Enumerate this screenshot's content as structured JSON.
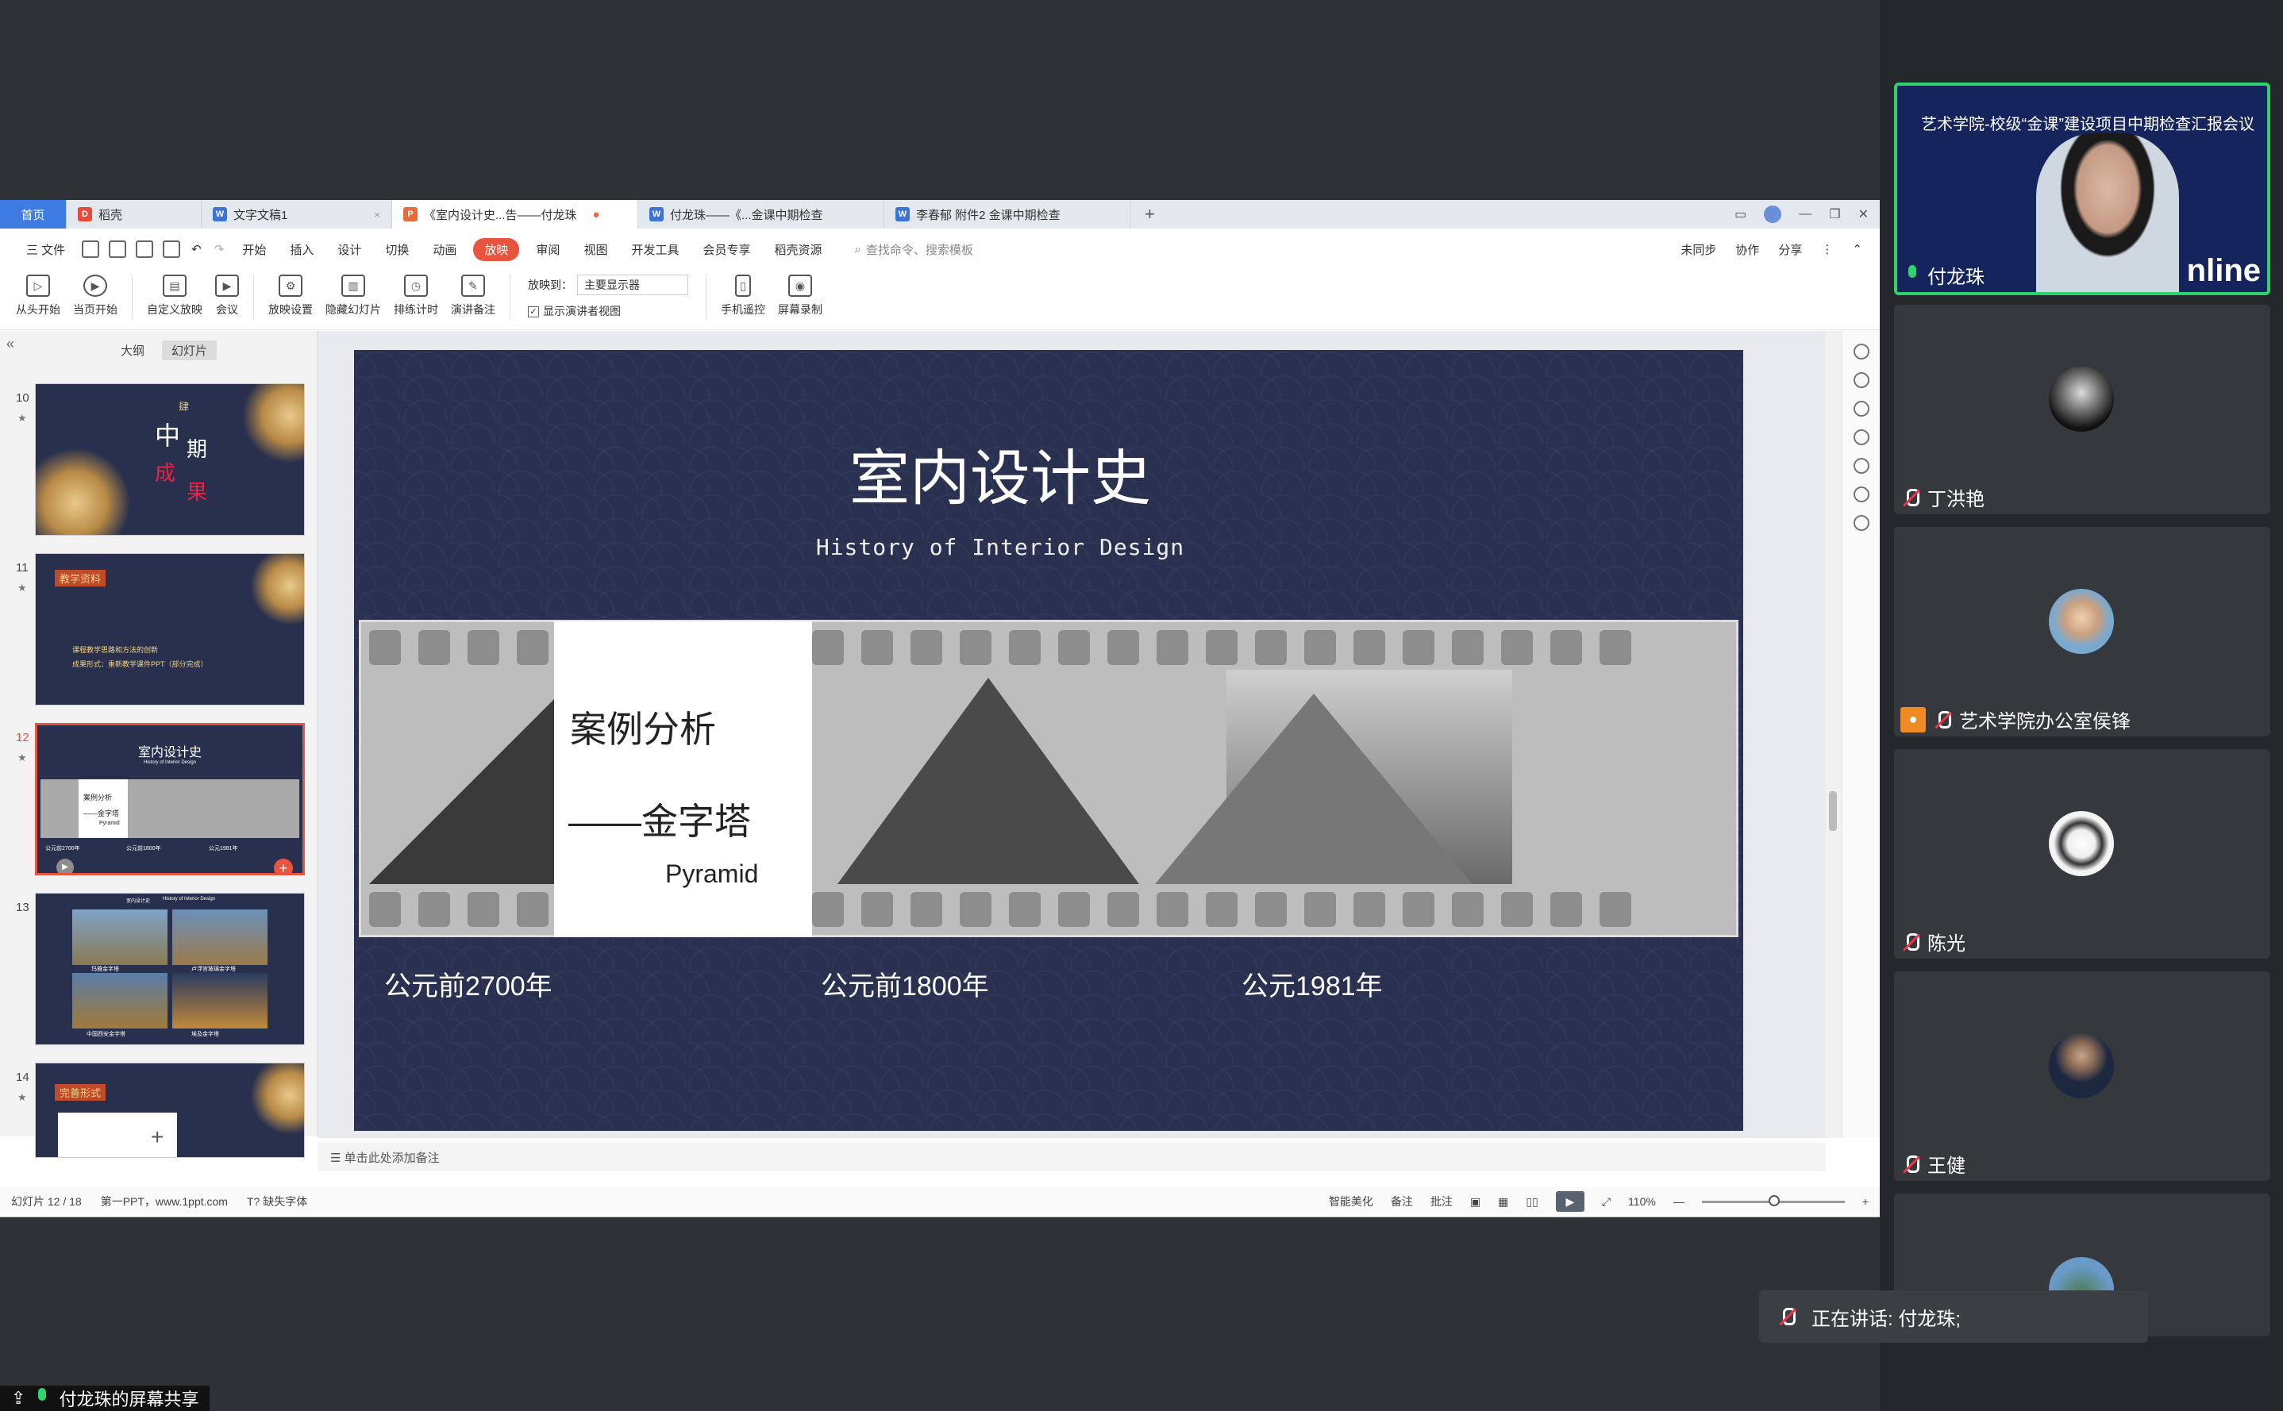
{
  "wps": {
    "tabs": [
      {
        "label": "首页"
      },
      {
        "label": "稻壳",
        "icon": "docer-icon"
      },
      {
        "label": "文字文稿1",
        "icon": "word-icon"
      },
      {
        "label": "《室内设计史...告——付龙珠",
        "icon": "ppt-icon"
      },
      {
        "label": "付龙珠——《...金课中期检查",
        "icon": "word-icon"
      },
      {
        "label": "李春郁 附件2 金课中期检查",
        "icon": "word-icon"
      }
    ],
    "menu": {
      "file": "三 文件",
      "items": [
        "开始",
        "插入",
        "设计",
        "切换",
        "动画",
        "放映",
        "审阅",
        "视图",
        "开发工具",
        "会员专享",
        "稻壳资源"
      ],
      "active": "放映",
      "search": "查找命令、搜索模板",
      "right": [
        "未同步",
        "协作",
        "分享"
      ]
    },
    "ribbon": {
      "buttons": [
        "从头开始",
        "当页开始",
        "自定义放映",
        "会议",
        "放映设置",
        "隐藏幻灯片",
        "排练计时",
        "演讲备注"
      ],
      "play_to_label": "放映到：",
      "play_to_value": "主要显示器",
      "presenter_view": "显示演讲者视图",
      "extra": [
        "手机遥控",
        "屏幕录制"
      ]
    },
    "pane": {
      "tabs": [
        "大纲",
        "幻灯片"
      ],
      "active": "幻灯片"
    },
    "thumbnails": [
      {
        "num": "10",
        "texts": [
          "肆",
          "中",
          "期",
          "成",
          "果"
        ]
      },
      {
        "num": "11",
        "texts": [
          "教学资料",
          "课程教学思路和方法的创新",
          "成果形式：重新教学课件PPT（部分完成）"
        ]
      },
      {
        "num": "12",
        "texts": [
          "室内设计史",
          "History of Interior Design",
          "案例分析",
          "——金字塔",
          "Pyramid",
          "公元前2700年",
          "公元前1800年",
          "公元1981年"
        ]
      },
      {
        "num": "13",
        "texts": [
          "室内设计史",
          "History of Interior Design",
          "玛雅金字塔",
          "卢浮宫玻璃金字塔",
          "中国西安金字塔",
          "埃及金字塔"
        ]
      },
      {
        "num": "14",
        "texts": [
          "完善形式"
        ]
      }
    ],
    "slide": {
      "title": "室内设计史",
      "subtitle": "History of Interior Design",
      "case_title": "案例分析",
      "case_sub": "——金字塔",
      "case_en": "Pyramid",
      "years": [
        "公元前2700年",
        "公元前1800年",
        "公元1981年"
      ]
    },
    "notes_placeholder": "单击此处添加备注",
    "status": {
      "slide_count": "幻灯片 12 / 18",
      "theme": "第一PPT，www.1ppt.com",
      "missing_font": "缺失字体",
      "smart": "智能美化",
      "notes": "备注",
      "comments": "批注",
      "zoom": "110%"
    }
  },
  "share_label": "付龙珠的屏幕共享",
  "participants": [
    {
      "name": "付龙珠",
      "video": true,
      "video_title": "艺术学院-校级“金课”建设项目中期检查汇报会议",
      "brand": "nline"
    },
    {
      "name": "丁洪艳"
    },
    {
      "name": "艺术学院办公室侯锋"
    },
    {
      "name": "陈光"
    },
    {
      "name": "王健"
    },
    {
      "name": ""
    }
  ],
  "speaking": "正在讲话: 付龙珠;"
}
